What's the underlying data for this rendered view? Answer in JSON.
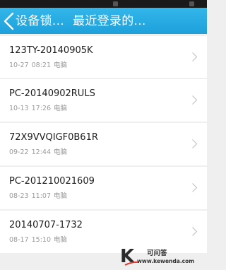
{
  "header": {
    "back_icon": "chevron-left-icon",
    "title_part1": "设备锁...",
    "title_part2": "最近登录的...",
    "background": "#1ea0db"
  },
  "devices": [
    {
      "name": "123TY-20140905K",
      "date": "10-27",
      "time": "08:21",
      "type": "电脑"
    },
    {
      "name": "PC-20140902RULS",
      "date": "10-13",
      "time": "17:26",
      "type": "电脑"
    },
    {
      "name": "72X9VVQIGF0B61R",
      "date": "09-22",
      "time": "12:44",
      "type": "电脑"
    },
    {
      "name": "PC-201210021609",
      "date": "08-23",
      "time": "11:07",
      "type": "电脑"
    },
    {
      "name": "20140707-1732",
      "date": "08-17",
      "time": "15:10",
      "type": "电脑"
    }
  ],
  "watermark": {
    "letter": "K",
    "site_name": "可问答",
    "url": "www.kewenda.com"
  }
}
